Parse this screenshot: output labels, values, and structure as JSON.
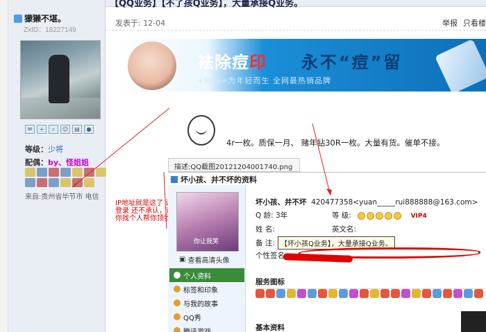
{
  "thread": {
    "title": "【QQ业务】【不了孩Q业务】，大量承接Q业务。"
  },
  "user": {
    "name": "獴獭不堪。",
    "zxid": "ZxID：18227149",
    "level_label": "等级：",
    "level_value": "少将",
    "config_label": "配偶：",
    "config_value": "by、怪姐姐",
    "from": "来自:贵州省毕节市 电信"
  },
  "post": {
    "time": "发表于: 12-04",
    "report": "举报",
    "only_author": "只看楼",
    "text": "4r一枚。质保一月、 赌年钻30R一枚。大量有货。催单不接。",
    "caption": "描述:QQ截图20121204001740.png"
  },
  "banner": {
    "line1_a": "祛除痘",
    "line1_b": "印",
    "line2": "永不“痘”留",
    "line3": "+WIS+为年轻而生  全网最热销品牌"
  },
  "annotation": {
    "ip_text": "IP地址就是这了 证实就是他登录 还不承认，远程让我把 你找个人帮你顶我知道你了"
  },
  "qq": {
    "header": "坏小孩、并不坏的资料",
    "avatar_caption": "你让我笑",
    "view_avatar": "查看高清头像",
    "menu": [
      "个人资料",
      "标签和印象",
      "与我的故事",
      "QQ秀",
      "腾讯游戏"
    ],
    "nick": "坏小孩、并不坏",
    "qq_line": "420477358<yuan_____rui888888@163.com>",
    "age_label": "Q  龄: 3年",
    "grade_label": "等  级:",
    "vip": "VIP4",
    "name_label": "姓  名:",
    "en_name_label": "英文名:",
    "note_label": "备  注:",
    "tip": "【坏小孩Q业务】，大量承接Q业务。",
    "sign_label": "个性签名:",
    "service_title": "服务图标",
    "basic_title": "基本资料"
  },
  "icons": {
    "user": "user-icon",
    "tools": [
      "mail-icon",
      "add-friend-icon",
      "search-icon",
      "profile-icon",
      "card-icon",
      "qq-icon"
    ]
  }
}
